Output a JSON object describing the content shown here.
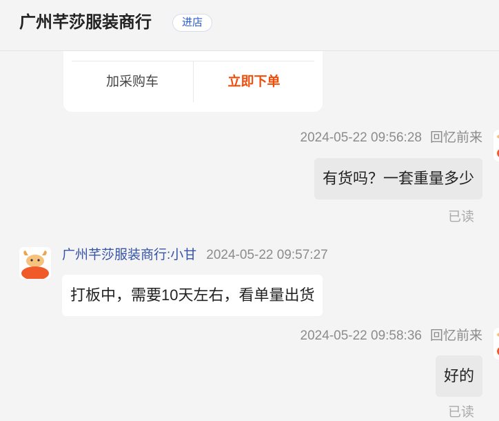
{
  "header": {
    "shop_name": "广州芊莎服装商行",
    "enter_store_label": "进店"
  },
  "product_card": {
    "add_to_cart_label": "加采购车",
    "buy_now_label": "立即下单"
  },
  "messages": [
    {
      "sender": "self",
      "timestamp": "2024-05-22 09:56:28",
      "name": "回忆前来",
      "text": "有货吗？一套重量多少",
      "status": "已读"
    },
    {
      "sender": "other",
      "name": "广州芊莎服装商行:小甘",
      "timestamp": "2024-05-22 09:57:27",
      "text": "打板中，需要10天左右，看单量出货"
    },
    {
      "sender": "self",
      "timestamp": "2024-05-22 09:58:36",
      "name": "回忆前来",
      "text": "好的",
      "status": "已读"
    }
  ],
  "colors": {
    "accent_orange": "#f04d0b",
    "link_blue": "#2a5bd7",
    "seller_name_blue": "#3553a8",
    "background": "#f4f4f4"
  },
  "icons": {
    "seller_avatar": "cow-mascot-avatar",
    "buyer_avatar": "cow-mascot-avatar"
  }
}
